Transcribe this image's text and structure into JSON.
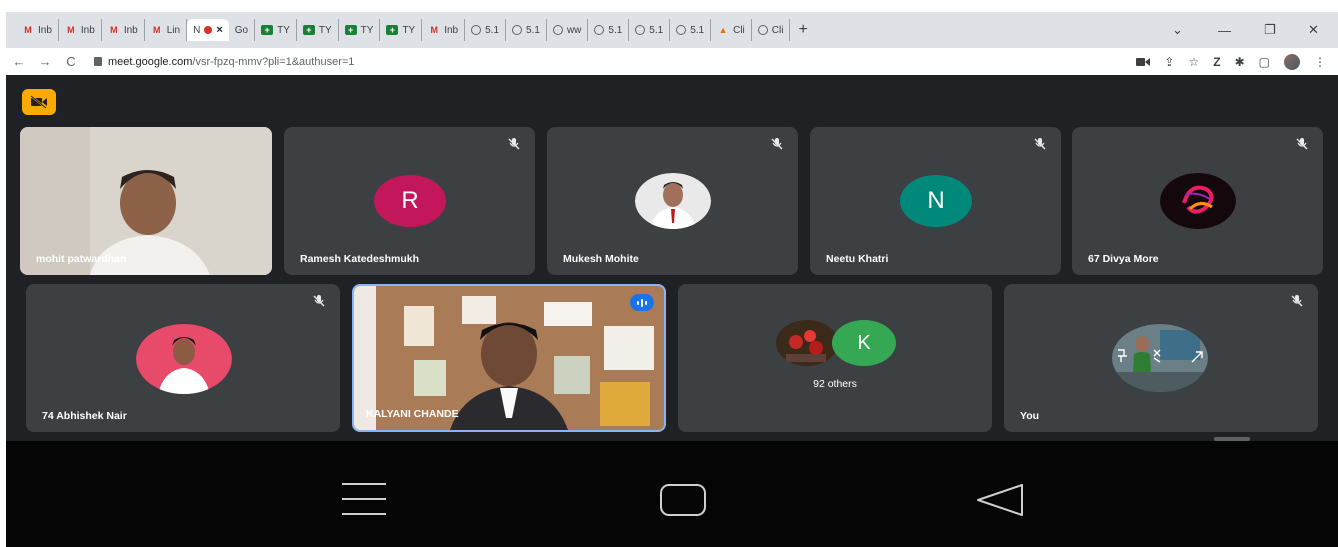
{
  "browser": {
    "tabs": [
      {
        "type": "gmail",
        "label": "Inb"
      },
      {
        "type": "gmail",
        "label": "Inb"
      },
      {
        "type": "gmail",
        "label": "Inb"
      },
      {
        "type": "gmail",
        "label": "Lin"
      },
      {
        "type": "meet-active",
        "label": "N"
      },
      {
        "type": "meet",
        "label": "Go"
      },
      {
        "type": "sheet",
        "label": "TY"
      },
      {
        "type": "sheet",
        "label": "TY"
      },
      {
        "type": "sheet",
        "label": "TY"
      },
      {
        "type": "sheet",
        "label": "TY"
      },
      {
        "type": "gmail",
        "label": "Inb"
      },
      {
        "type": "globe",
        "label": "5.1"
      },
      {
        "type": "globe",
        "label": "5.1"
      },
      {
        "type": "globe",
        "label": "ww"
      },
      {
        "type": "globe",
        "label": "5.1"
      },
      {
        "type": "globe",
        "label": "5.1"
      },
      {
        "type": "globe",
        "label": "5.1"
      },
      {
        "type": "clip",
        "label": "Cli"
      },
      {
        "type": "globe",
        "label": "Cli"
      }
    ],
    "new_tab": "+",
    "tab_close": "×",
    "window_controls": {
      "menu": "⌄",
      "minimize": "—",
      "restore": "❐",
      "close": "✕"
    },
    "nav": {
      "back": "←",
      "forward": "→",
      "reload": "C"
    },
    "url_host": "meet.google.com",
    "url_path": "/vsr-fpzq-mmv?pli=1&authuser=1",
    "toolbar": {
      "share": "⇪",
      "star": "☆",
      "ext1": "Z",
      "puzzle": "✱",
      "sidebar": "▢",
      "more": "⋮"
    }
  },
  "meet": {
    "participants_row1": [
      {
        "name": "mohit patwardhan",
        "kind": "video"
      },
      {
        "name": "Ramesh Katedeshmukh",
        "kind": "letter",
        "letter": "R",
        "color": "#c2185b",
        "muted": true
      },
      {
        "name": "Mukesh Mohite",
        "kind": "photo",
        "muted": true
      },
      {
        "name": "Neetu Khatri",
        "kind": "letter",
        "letter": "N",
        "color": "#00897b",
        "muted": true
      },
      {
        "name": "67 Divya More",
        "kind": "photo",
        "muted": true
      }
    ],
    "participants_row2": [
      {
        "name": "74 Abhishek Nair",
        "kind": "photo",
        "muted": true
      },
      {
        "name": "KALYANI CHANDE",
        "kind": "video",
        "speaking": true
      },
      {
        "name": "92 others",
        "kind": "group",
        "letter": "K",
        "color": "#34a853"
      },
      {
        "name": "You",
        "kind": "photo",
        "muted": true
      }
    ]
  },
  "android_nav": {
    "recents": "recents-icon",
    "home": "home-icon",
    "back": "back-icon"
  }
}
